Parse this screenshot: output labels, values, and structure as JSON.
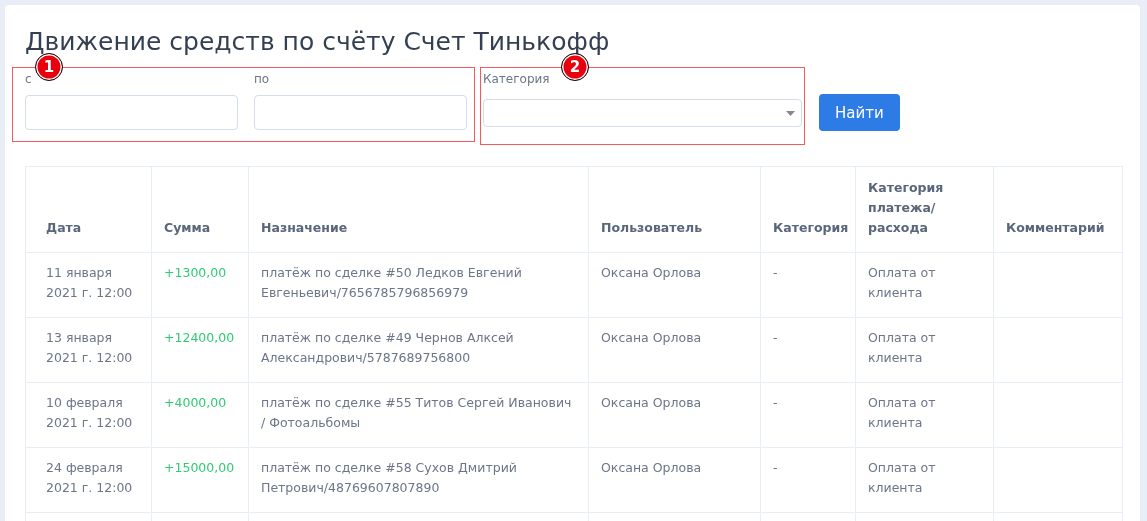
{
  "title": "Движение средств по счёту Счет Тинькофф",
  "filter_groups": [
    {
      "callout": "1",
      "fields": [
        {
          "label": "с",
          "kind": "text"
        },
        {
          "label": "по",
          "kind": "text"
        }
      ]
    },
    {
      "callout": "2",
      "fields": [
        {
          "label": "Категория",
          "kind": "select"
        }
      ]
    }
  ],
  "search_button": "Найти",
  "table": {
    "columns": [
      "Дата",
      "Сумма",
      "Назначение",
      "Пользователь",
      "Категория",
      "Категория платежа/ расхода",
      "Комментарий"
    ],
    "rows": [
      {
        "date": "11 января 2021 г. 12:00",
        "amount": "+1300,00",
        "purpose": "платёж по сделке #50 Ледков Евгений Евгеньевич/7656785796856979",
        "user": "Оксана Орлова",
        "category": "-",
        "payment_category": "Оплата от клиента"
      },
      {
        "date": "13 января 2021 г. 12:00",
        "amount": "+12400,00",
        "purpose": "платёж по сделке #49 Чернов Алксей Александрович/5787689756800",
        "user": "Оксана Орлова",
        "category": "-",
        "payment_category": "Оплата от клиента"
      },
      {
        "date": "10 февраля 2021 г. 12:00",
        "amount": "+4000,00",
        "purpose": "платёж по сделке #55 Титов Сергей Иванович / Фотоальбомы",
        "user": "Оксана Орлова",
        "category": "-",
        "payment_category": "Оплата от клиента"
      },
      {
        "date": "24 февраля 2021 г. 12:00",
        "amount": "+15000,00",
        "purpose": "платёж по сделке #58 Сухов Дмитрий Петрович/48769607807890",
        "user": "Оксана Орлова",
        "category": "-",
        "payment_category": "Оплата от клиента"
      }
    ]
  }
}
